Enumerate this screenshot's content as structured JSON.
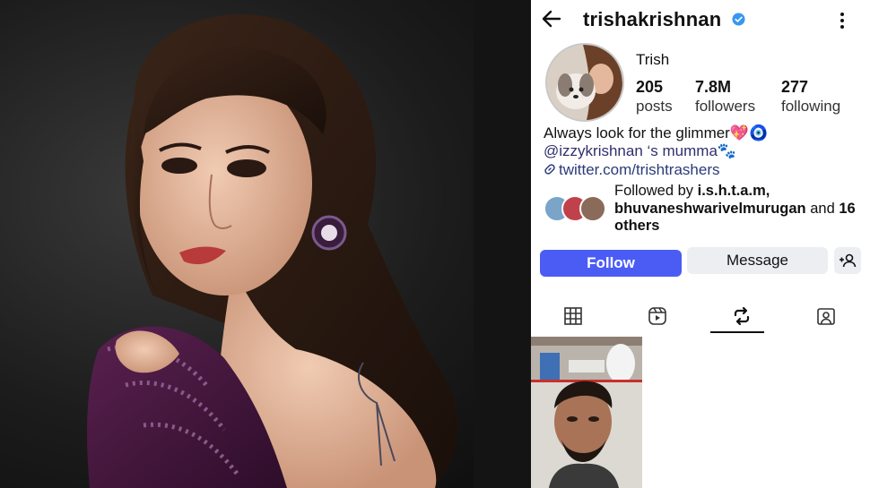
{
  "profile": {
    "username": "trishakrishnan",
    "name": "Trish",
    "stats": [
      {
        "num": "205",
        "label": "posts"
      },
      {
        "num": "7.8M",
        "label": "followers"
      },
      {
        "num": "277",
        "label": "following"
      }
    ],
    "bio_line1": "Always look for the glimmer💖🧿",
    "bio_line2": "@izzykrishnan ‘s mumma🐾",
    "link": "twitter.com/trishtrashers",
    "followed_by_prefix": "Followed by ",
    "followed_by_names": "i.s.h.t.a.m, bhuvaneshwarivelmurugan",
    "followed_by_suffix": " and ",
    "followed_by_others": "16 others",
    "follow_label": "Follow",
    "message_label": "Message"
  },
  "icons": {
    "back": "back-arrow-icon",
    "verified": "verified-badge-icon",
    "more": "more-vertical-icon",
    "add_user": "add-user-icon",
    "tabs": [
      "grid-icon",
      "reels-icon",
      "reposts-icon",
      "tagged-icon"
    ]
  },
  "colors": {
    "follow_button": "#4b5cf5",
    "verified": "#3897f0",
    "link": "#2b3b7a"
  }
}
